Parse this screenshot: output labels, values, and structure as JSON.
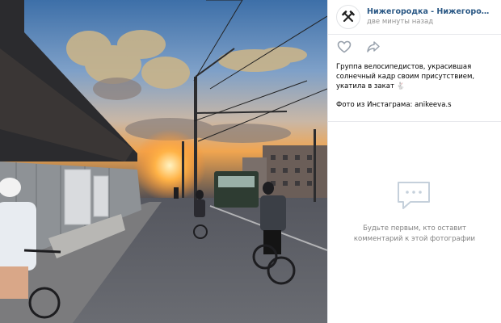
{
  "photo": {
    "alt_icon": "photo-of-cyclists-at-sunset"
  },
  "post": {
    "group_name": "Нижегородка - Нижегородский ЮВ...",
    "timestamp": "две минуты назад",
    "caption_lines": [
      "Группа велосипедистов, украсившая",
      "солнечный кадр своим присутствием,",
      "укатила в закат"
    ],
    "caption_emoji": "🐇",
    "source_line": "Фото из Инстаграма: anikeeva.s"
  },
  "comments": {
    "empty_line1": "Будьте первым, кто оставит",
    "empty_line2": "комментарий к этой фотографии"
  },
  "icons": {
    "like": "heart-icon",
    "share": "share-icon",
    "avatar": "hammer-pick-icon",
    "comments": "speech-bubble-icon"
  },
  "colors": {
    "link": "#2a5885",
    "muted": "#939393",
    "icon": "#99a2ad"
  }
}
